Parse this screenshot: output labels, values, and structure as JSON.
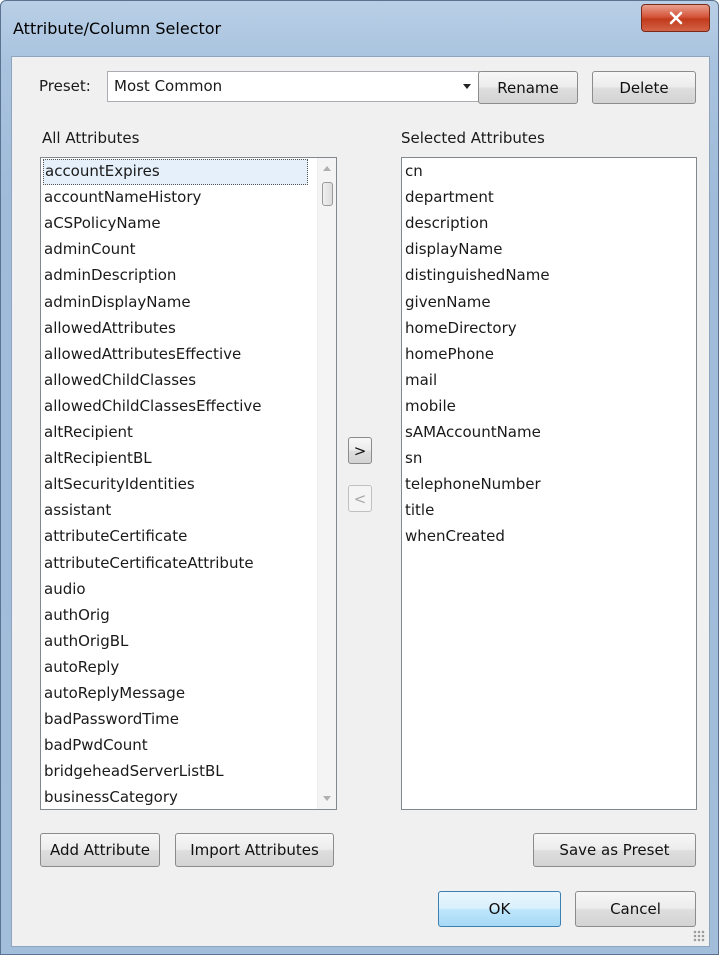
{
  "window": {
    "title": "Attribute/Column Selector",
    "close_glyph": "X"
  },
  "preset": {
    "label": "Preset:",
    "value": "Most Common",
    "rename_label": "Rename",
    "delete_label": "Delete"
  },
  "all_attributes": {
    "label": "All Attributes",
    "selected_index": 0,
    "items": [
      "accountExpires",
      "accountNameHistory",
      "aCSPolicyName",
      "adminCount",
      "adminDescription",
      "adminDisplayName",
      "allowedAttributes",
      "allowedAttributesEffective",
      "allowedChildClasses",
      "allowedChildClassesEffective",
      "altRecipient",
      "altRecipientBL",
      "altSecurityIdentities",
      "assistant",
      "attributeCertificate",
      "attributeCertificateAttribute",
      "audio",
      "authOrig",
      "authOrigBL",
      "autoReply",
      "autoReplyMessage",
      "badPasswordTime",
      "badPwdCount",
      "bridgeheadServerListBL",
      "businessCategory"
    ],
    "add_label": "Add Attribute",
    "import_label": "Import Attributes"
  },
  "transfer": {
    "add_glyph": ">",
    "remove_glyph": "<"
  },
  "selected_attributes": {
    "label": "Selected Attributes",
    "items": [
      "cn",
      "department",
      "description",
      "displayName",
      "distinguishedName",
      "givenName",
      "homeDirectory",
      "homePhone",
      "mail",
      "mobile",
      "sAMAccountName",
      "sn",
      "telephoneNumber",
      "title",
      "whenCreated"
    ],
    "save_preset_label": "Save as Preset"
  },
  "footer": {
    "ok_label": "OK",
    "cancel_label": "Cancel"
  },
  "colors": {
    "close_button": "#c9482c",
    "selection_bg": "#e6f0fa",
    "ok_border": "#3c7fb1"
  }
}
